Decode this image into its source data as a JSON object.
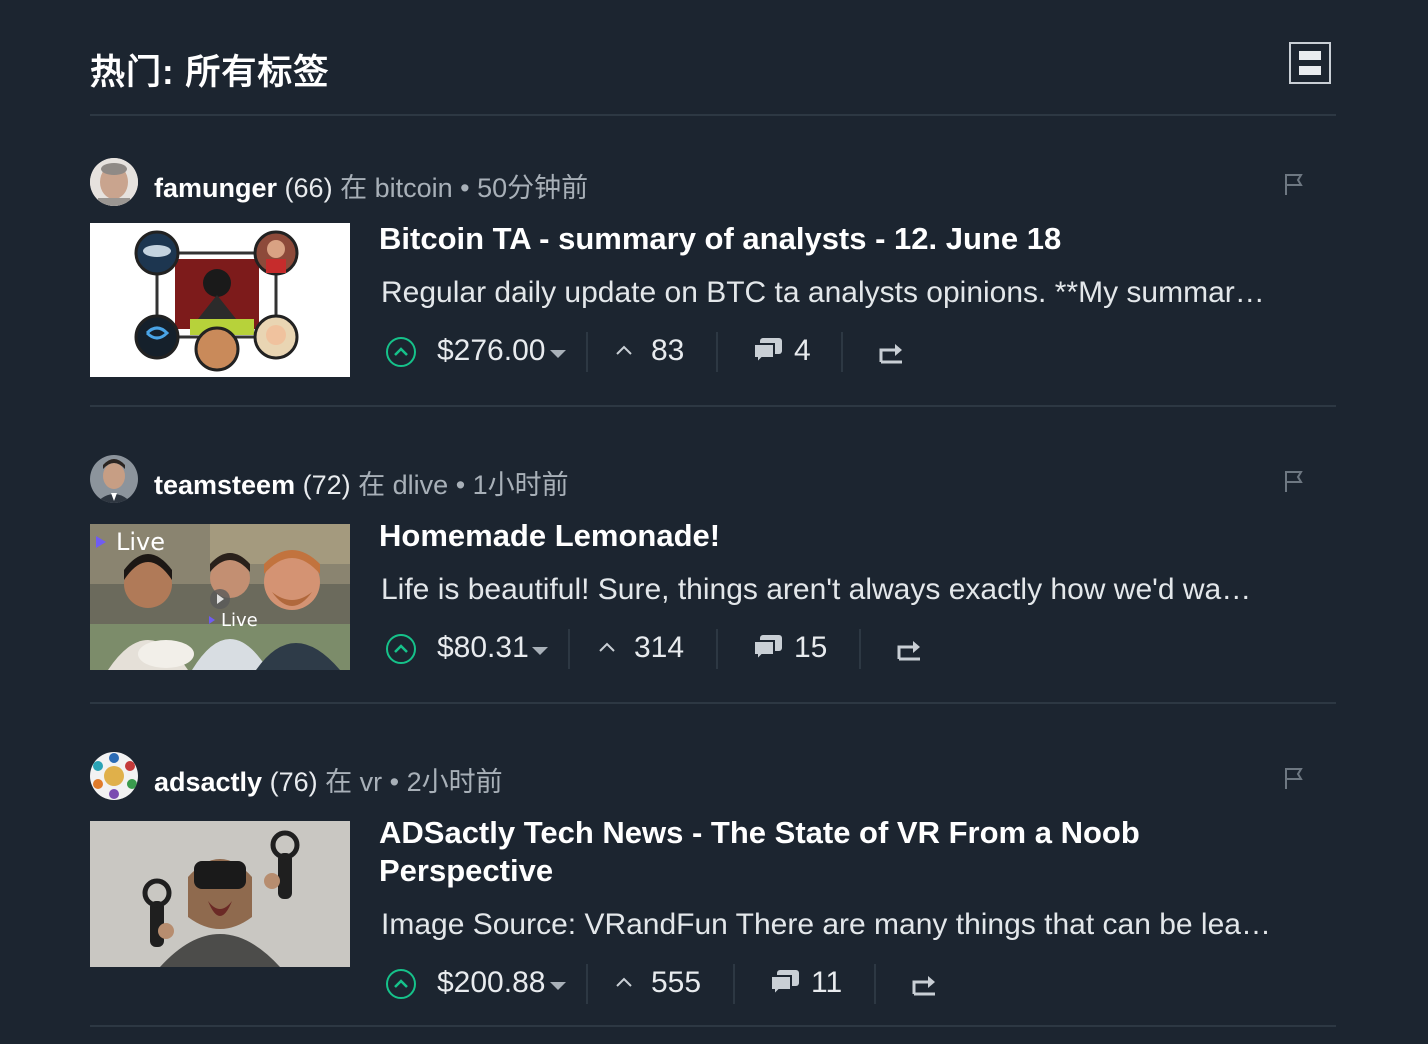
{
  "header": {
    "title": "热门: 所有标签"
  },
  "posts": [
    {
      "author": "famunger",
      "reputation": "(66)",
      "in_label": "在",
      "category": "bitcoin",
      "separator": "•",
      "time": "50分钟前",
      "title": "Bitcoin TA - summary of analysts - 12. June 18",
      "summary": "Regular daily update on BTC ta analysts opinions. **My summar…",
      "payout": "$276.00",
      "votes": "83",
      "comments": "4"
    },
    {
      "author": "teamsteem",
      "reputation": "(72)",
      "in_label": "在",
      "category": "dlive",
      "separator": "•",
      "time": "1小时前",
      "title": "Homemade Lemonade!",
      "summary": "Life is beautiful! Sure, things aren't always exactly how we'd wa…",
      "payout": "$80.31",
      "votes": "314",
      "comments": "15",
      "thumb_text": "Live",
      "thumb_text_2": "Live"
    },
    {
      "author": "adsactly",
      "reputation": "(76)",
      "in_label": "在",
      "category": "vr",
      "separator": "•",
      "time": "2小时前",
      "title": "ADSactly Tech News - The State of VR From a Noob Perspective",
      "summary": "Image Source: VRandFun There are many things that can be lea…",
      "payout": "$200.88",
      "votes": "555",
      "comments": "11"
    }
  ],
  "colors": {
    "background": "#1c2530",
    "accent_upvote": "#16c28a",
    "divider": "#2d3843"
  }
}
